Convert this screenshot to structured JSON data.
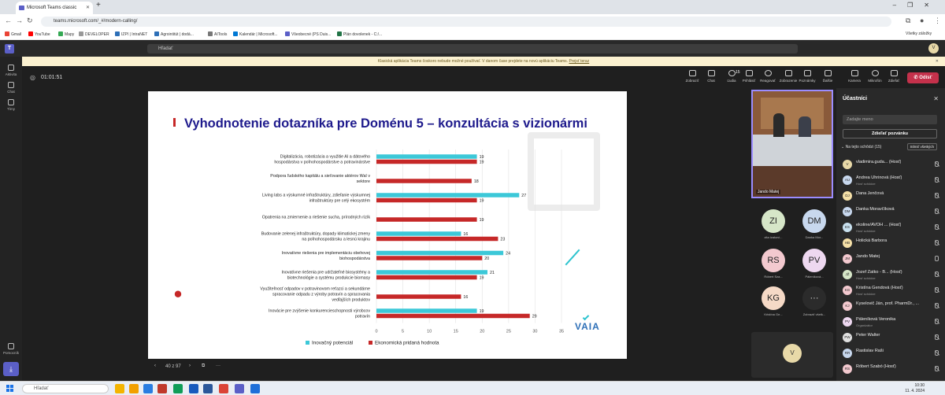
{
  "browser": {
    "tab_title": "Microsoft Teams classic",
    "url": "teams.microsoft.com/_#/modern-calling/",
    "bookmarks": [
      "Gmail",
      "YouTube",
      "Mapy",
      "DEVELOPER",
      "IZPI | IntraNET",
      "Agrointitút | dodá...",
      "AITools",
      "Kalendár | Microsoft...",
      "Všeobecné (PS Duis...",
      "Plán dovolenek - C:/..."
    ],
    "all_bookmarks": "Všetky záložky"
  },
  "teams": {
    "search_placeholder": "Hľadať",
    "avatar_initial": "V",
    "banner": "Klasická aplikácia Teams čoskoro nebude možné používať. V danom čase prejdete na novú aplikáciu Teams. ",
    "banner_link": "Prejsť teraz",
    "rail": [
      "Aktivita",
      "Chat",
      "Tímy",
      "Pomocník"
    ],
    "timer": "01:01:51",
    "controls": {
      "view": "Zobraziť",
      "chat": "Chat",
      "people": "Ľudia",
      "people_count": "15",
      "raise": "Prihlásiť",
      "react": "Reagovať",
      "rooms": "Zobrazenie",
      "notes": "Poznámky",
      "more": "Ďalšie",
      "camera": "Kamera",
      "mic": "Mikrofón",
      "share": "Zdieľať",
      "leave": "Odísť"
    },
    "slide_nav": {
      "page": "40 z 97"
    }
  },
  "slide": {
    "title": "Vyhodnotenie dotazníka pre Doménu 5 – konzultácia s vizionármi",
    "logo_text": "VAIA"
  },
  "chart_data": {
    "type": "bar",
    "orientation": "horizontal",
    "categories": [
      "Digitalizácia, robotizácia a využitie AI a dátového hospodárstva v poľnohospodárstve a potravinárstve",
      "Podpora ľudského kapitálu a sieťovanie aktérov WaI v sektore",
      "Living labs a výskumné infraštruktúry, zdieľanie výskumnej infraštruktúry pre celý ekosystém",
      "Opatrenia na zmiernenie a riešenie sucha, prírodných rizík",
      "Budovanie zelenej infraštruktúry, dopady klimatickej zmeny na poľnohospodársku a lesnú krajinu",
      "Inovatívne riešenia pre implementáciu obehovej biohospodárstva",
      "Inovatívne riešenia pre udržateľné biosystémy a biotechnológie a systému produkcie biomasy",
      "Využiteľnosť odpadov v potravinovom reťazci a sekundárne spracovanie odpadu z výroby potravín a spracovania vedľajších produktov",
      "Inovácie pre zvýšenie konkurencieschopnosti výrobcov potravín"
    ],
    "series": [
      {
        "name": "Inovačný potenciál",
        "color": "#3cc8d8",
        "values": [
          19,
          null,
          27,
          null,
          16,
          24,
          21,
          null,
          19
        ]
      },
      {
        "name": "Ekonomická pridaná hodnota",
        "color": "#c62828",
        "values": [
          19,
          18,
          19,
          19,
          23,
          20,
          19,
          16,
          29
        ]
      }
    ],
    "xlim": [
      0,
      35
    ],
    "xticks": [
      0,
      5,
      10,
      15,
      20,
      25,
      30,
      35
    ],
    "grid": true,
    "legend_position": "bottom",
    "highlight_marker_category_index": 7
  },
  "gallery": {
    "video_name": "Jando Matej",
    "tiles": [
      {
        "initials": "ZI",
        "name": "zita izakovi...",
        "color": "#d6e6c8"
      },
      {
        "initials": "DM",
        "name": "Danka Mor...",
        "color": "#c8d8ee"
      },
      {
        "initials": "RS",
        "name": "Róbert Sza...",
        "color": "#f3c9cf"
      },
      {
        "initials": "PV",
        "name": "Páleníková...",
        "color": "#eed8f0"
      },
      {
        "initials": "KG",
        "name": "Kristína Ge...",
        "color": "#f5d9c6"
      },
      {
        "initials": "···",
        "name": "Zobraziť všetk...",
        "color": "#2b2b2b"
      }
    ],
    "self_initial": "V"
  },
  "participants": {
    "title": "Účastníci",
    "search_placeholder": "Zadajte meno",
    "share_invite": "Zdieľať pozvánku",
    "section": "Na tejto schôdzi (15)",
    "mute_all": "Stlmiť všetkých",
    "list": [
      {
        "initials": "V",
        "name": "vladimira.guda... (Hosť)",
        "sub": "",
        "color": "#e8d9a8",
        "mic": "off"
      },
      {
        "initials": "AU",
        "name": "Andrea Uhrinová (Hosť)",
        "sub": "Hosť schôdze",
        "color": "#c8d8ee",
        "mic": "off"
      },
      {
        "initials": "DJ",
        "name": "Dana Jenčová",
        "sub": "",
        "color": "#f5e0a8",
        "mic": "off"
      },
      {
        "initials": "DM",
        "name": "Danka Moravčíková",
        "sub": "",
        "color": "#c8d8ee",
        "mic": "off"
      },
      {
        "initials": "ES",
        "name": "ekoline/AVOH ... (Hosť)",
        "sub": "Hosť schôdze",
        "color": "#c8e0ee",
        "mic": "off"
      },
      {
        "initials": "HB",
        "name": "Holická Barbora",
        "sub": "",
        "color": "#f5e0a8",
        "mic": "off"
      },
      {
        "initials": "JM",
        "name": "Jando Matej",
        "sub": "",
        "color": "#f3c9cf",
        "mic": "on"
      },
      {
        "initials": "JŽ",
        "name": "Jozef Žatko - B... (Hosť)",
        "sub": "Hosť schôdze",
        "color": "#d6e6c8",
        "mic": "off"
      },
      {
        "initials": "KG",
        "name": "Kristína Gendová (Hosť)",
        "sub": "Hosť schôdze",
        "color": "#f3c9cf",
        "mic": "off"
      },
      {
        "initials": "KJ",
        "name": "Kyselovič Ján, prof. PharmDr., ...",
        "sub": "",
        "color": "#f3c9cf",
        "mic": "off"
      },
      {
        "initials": "PV",
        "name": "Páleníková Veronika",
        "sub": "Organizátor",
        "color": "#eed8f0",
        "mic": "off"
      },
      {
        "initials": "PW",
        "name": "Peter Walter",
        "sub": "",
        "color": "#e0e0e0",
        "mic": "off"
      },
      {
        "initials": "RR",
        "name": "Rastislav Raši",
        "sub": "",
        "color": "#c8d8ee",
        "mic": "off"
      },
      {
        "initials": "RS",
        "name": "Róbert Szabó (Hosť)",
        "sub": "",
        "color": "#f3c9cf",
        "mic": "off"
      }
    ]
  },
  "taskbar": {
    "search": "Hľadať",
    "time": "10:30",
    "date": "11. 4. 2024"
  }
}
